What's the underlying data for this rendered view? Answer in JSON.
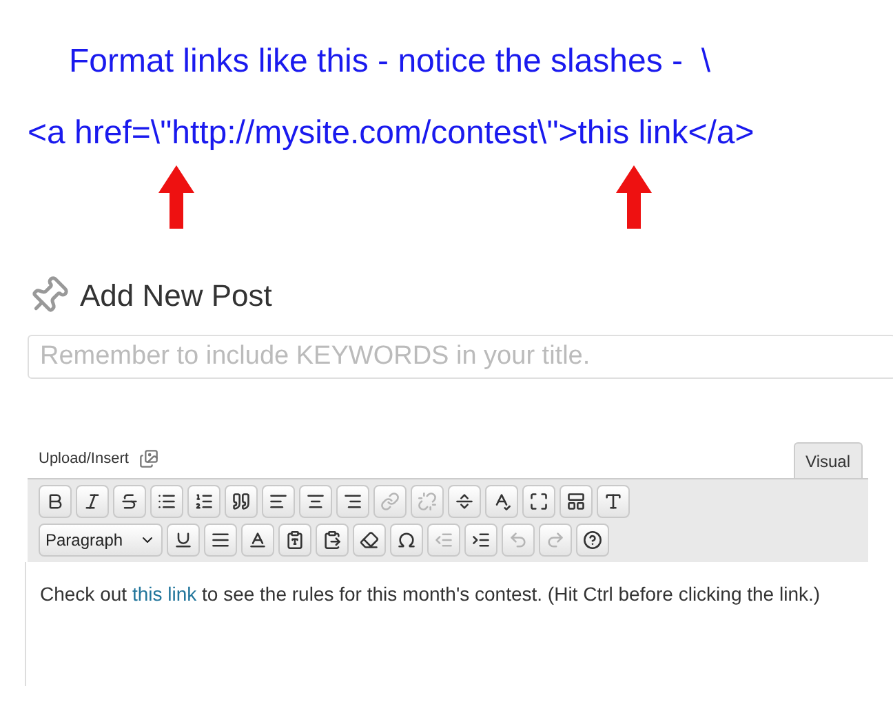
{
  "annotation": {
    "lines": [
      "Format links like this - notice the slashes -  \\",
      "<a href=\\\"http://mysite.com/contest\\\">this link</a>"
    ]
  },
  "page_title": "Add New Post",
  "title_field": {
    "placeholder": "Remember to include KEYWORDS in your title."
  },
  "upload_insert": "Upload/Insert",
  "editor_tabs": [
    {
      "label": "Visual",
      "selected": true
    }
  ],
  "toolbar": {
    "row_1": [
      {
        "disabled": false
      },
      {
        "disabled": false
      },
      {
        "disabled": false
      },
      {
        "disabled": false
      },
      {
        "disabled": false
      },
      {
        "disabled": false
      },
      {
        "disabled": false
      },
      {
        "disabled": false
      },
      {
        "disabled": false
      },
      {
        "disabled": true
      },
      {
        "disabled": true
      },
      {
        "disabled": false
      },
      {
        "disabled": false
      },
      {
        "disabled": false
      },
      {
        "disabled": false
      },
      {
        "disabled": false
      }
    ],
    "format_select": "Paragraph",
    "row_2": [
      {
        "disabled": false
      },
      {
        "disabled": false
      },
      {
        "disabled": false
      },
      {
        "disabled": false
      },
      {
        "disabled": false
      },
      {
        "disabled": false
      },
      {
        "disabled": false
      },
      {
        "disabled": true
      },
      {
        "disabled": false
      },
      {
        "disabled": true
      },
      {
        "disabled": true
      },
      {
        "disabled": false
      }
    ]
  },
  "content": {
    "before": "Check out ",
    "link": "this link",
    "after": " to see the rules for this month's contest. (Hit Ctrl before clicking the link.)"
  }
}
